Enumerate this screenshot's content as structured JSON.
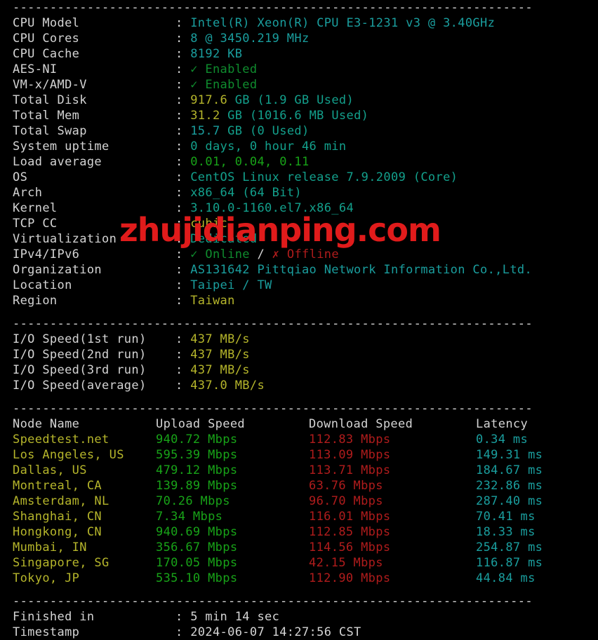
{
  "separator": "----------------------------------------------------------------------",
  "watermark": "zhujidianping.com",
  "colors": {
    "background": "#000000",
    "label": "#d4d4d4",
    "cyan": "#1a9e9e",
    "teal": "#13a08c",
    "green": "#18a318",
    "yellow": "#b5b52b",
    "red": "#b01c1c",
    "watermark": "#e01b1b"
  },
  "sysinfo": {
    "rows": [
      {
        "label": "CPU Model",
        "colon": ":",
        "value": "Intel(R) Xeon(R) CPU E3-1231 v3 @ 3.40GHz"
      },
      {
        "label": "CPU Cores",
        "colon": ":",
        "value": "8 @ 3450.219 MHz"
      },
      {
        "label": "CPU Cache",
        "colon": ":",
        "value": "8192 KB"
      },
      {
        "label": "AES-NI",
        "colon": ":",
        "mark": "✓",
        "value": "Enabled"
      },
      {
        "label": "VM-x/AMD-V",
        "colon": ":",
        "mark": "✓",
        "value": "Enabled"
      },
      {
        "label": "Total Disk",
        "colon": ":",
        "num": "917.6",
        "unit": "GB",
        "extra": "(1.9 GB Used)"
      },
      {
        "label": "Total Mem",
        "colon": ":",
        "num": "31.2",
        "unit": "GB",
        "extra": "(1016.6 MB Used)"
      },
      {
        "label": "Total Swap",
        "colon": ":",
        "num": "15.7",
        "unit": "GB",
        "extra": "(0 Used)"
      },
      {
        "label": "System uptime",
        "colon": ":",
        "value": "0 days, 0 hour 46 min"
      },
      {
        "label": "Load average",
        "colon": ":",
        "value": "0.01, 0.04, 0.11"
      },
      {
        "label": "OS",
        "colon": ":",
        "value": "CentOS Linux release 7.9.2009 (Core)"
      },
      {
        "label": "Arch",
        "colon": ":",
        "value": "x86_64 (64 Bit)"
      },
      {
        "label": "Kernel",
        "colon": ":",
        "value": "3.10.0-1160.el7.x86_64"
      },
      {
        "label": "TCP CC",
        "colon": ":",
        "value": "cubic"
      },
      {
        "label": "Virtualization",
        "colon": ":",
        "value": "Dedicated"
      },
      {
        "label": "IPv4/IPv6",
        "colon": ":",
        "ipv4_mark": "✓",
        "ipv4": "Online",
        "slash": "/",
        "ipv6_mark": "✗",
        "ipv6": "Offline"
      },
      {
        "label": "Organization",
        "colon": ":",
        "value": "AS131642 Pittqiao Network Information Co.,Ltd."
      },
      {
        "label": "Location",
        "colon": ":",
        "value": "Taipei / TW"
      },
      {
        "label": "Region",
        "colon": ":",
        "value": "Taiwan"
      }
    ]
  },
  "io": {
    "rows": [
      {
        "label": "I/O Speed(1st run)",
        "colon": ":",
        "value": "437 MB/s"
      },
      {
        "label": "I/O Speed(2nd run)",
        "colon": ":",
        "value": "437 MB/s"
      },
      {
        "label": "I/O Speed(3rd run)",
        "colon": ":",
        "value": "437 MB/s"
      },
      {
        "label": "I/O Speed(average)",
        "colon": ":",
        "value": "437.0 MB/s"
      }
    ]
  },
  "speedtest": {
    "headers": {
      "node": "Node Name",
      "upload": "Upload Speed",
      "download": "Download Speed",
      "latency": "Latency"
    },
    "rows": [
      {
        "node": "Speedtest.net",
        "upload": "940.72 Mbps",
        "download": "112.83 Mbps",
        "latency": "0.34 ms"
      },
      {
        "node": "Los Angeles, US",
        "upload": "595.39 Mbps",
        "download": "113.09 Mbps",
        "latency": "149.31 ms"
      },
      {
        "node": "Dallas, US",
        "upload": "479.12 Mbps",
        "download": "113.71 Mbps",
        "latency": "184.67 ms"
      },
      {
        "node": "Montreal, CA",
        "upload": "139.89 Mbps",
        "download": "63.76 Mbps",
        "latency": "232.86 ms"
      },
      {
        "node": "Amsterdam, NL",
        "upload": "70.26 Mbps",
        "download": "96.70 Mbps",
        "latency": "287.40 ms"
      },
      {
        "node": "Shanghai, CN",
        "upload": "7.34 Mbps",
        "download": "116.01 Mbps",
        "latency": "70.41 ms"
      },
      {
        "node": "Hongkong, CN",
        "upload": "940.69 Mbps",
        "download": "112.85 Mbps",
        "latency": "18.33 ms"
      },
      {
        "node": "Mumbai, IN",
        "upload": "356.67 Mbps",
        "download": "114.56 Mbps",
        "latency": "254.87 ms"
      },
      {
        "node": "Singapore, SG",
        "upload": "170.05 Mbps",
        "download": "42.15 Mbps",
        "latency": "116.87 ms"
      },
      {
        "node": "Tokyo, JP",
        "upload": "535.10 Mbps",
        "download": "112.90 Mbps",
        "latency": "44.84 ms"
      }
    ]
  },
  "footer": {
    "rows": [
      {
        "label": "Finished in",
        "colon": ":",
        "value": "5 min 14 sec"
      },
      {
        "label": "Timestamp",
        "colon": ":",
        "value": "2024-06-07 14:27:56 CST"
      }
    ]
  }
}
